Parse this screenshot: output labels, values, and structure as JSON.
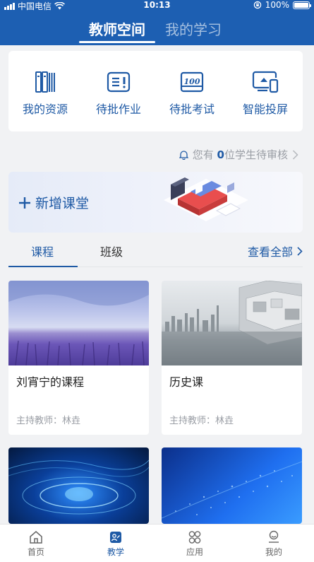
{
  "status_bar": {
    "carrier": "中国电信",
    "time": "10:13",
    "battery": "100%"
  },
  "header": {
    "tabs": [
      {
        "label": "教师空间",
        "active": true
      },
      {
        "label": "我的学习",
        "active": false
      }
    ]
  },
  "quick_actions": [
    {
      "label": "我的资源",
      "icon": "books-icon"
    },
    {
      "label": "待批作业",
      "icon": "homework-icon"
    },
    {
      "label": "待批考试",
      "icon": "exam-icon"
    },
    {
      "label": "智能投屏",
      "icon": "screen-cast-icon"
    }
  ],
  "notice": {
    "prefix": "您有",
    "count": "0",
    "suffix": "位学生待审核"
  },
  "banner": {
    "add_label": "新增课堂"
  },
  "section_tabs": {
    "tabs": [
      {
        "label": "课程",
        "active": true
      },
      {
        "label": "班级",
        "active": false
      }
    ],
    "view_all": "查看全部"
  },
  "courses": [
    {
      "title": "刘宵宁的课程",
      "teacher": "主持教师：林垚",
      "image": "lavender-field"
    },
    {
      "title": "历史课",
      "teacher": "主持教师：林垚",
      "image": "city-skyline"
    },
    {
      "title": "",
      "teacher": "",
      "image": "blue-tech-ring"
    },
    {
      "title": "",
      "teacher": "",
      "image": "blue-digital-particles"
    }
  ],
  "bottom_nav": [
    {
      "label": "首页",
      "icon": "home-icon",
      "active": false
    },
    {
      "label": "教学",
      "icon": "teaching-icon",
      "active": true
    },
    {
      "label": "应用",
      "icon": "apps-icon",
      "active": false
    },
    {
      "label": "我的",
      "icon": "profile-icon",
      "active": false
    }
  ],
  "colors": {
    "brand": "#1d5fb2",
    "accent": "#1f5aa5",
    "muted": "#9a9ea5"
  }
}
